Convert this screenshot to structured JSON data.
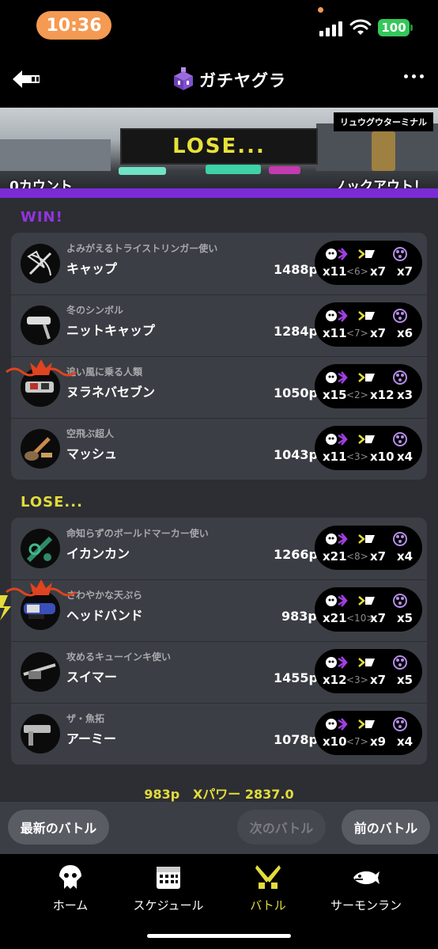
{
  "status_bar": {
    "time": "10:36",
    "battery": "100"
  },
  "header": {
    "title": "ガチヤグラ"
  },
  "banner": {
    "stage": "リュウグウターミナル",
    "result": "LOSE...",
    "left_count": "0カウント",
    "right_text": "ノックアウト！"
  },
  "win_label": "WIN!",
  "lose_label": "LOSE...",
  "win_team": [
    {
      "title": "よみがえるトライストリンガー使い",
      "name": "キャップ",
      "points": "1488p",
      "kills": "x11",
      "assists": "<6>",
      "specials_killed": "x7",
      "special_count": "x7",
      "weapon_icon": "bow-weapon-icon"
    },
    {
      "title": "冬のシンボル",
      "name": "ニットキャップ",
      "points": "1284p",
      "kills": "x11",
      "assists": "<7>",
      "specials_killed": "x7",
      "special_count": "x6",
      "weapon_icon": "roller-weapon-icon"
    },
    {
      "title": "追い風に乗る人類",
      "name": "ヌラネバセブン",
      "points": "1050p",
      "kills": "x15",
      "assists": "<2>",
      "specials_killed": "x12",
      "special_count": "x3",
      "weapon_icon": "shooter-weapon-icon"
    },
    {
      "title": "空飛ぶ超人",
      "name": "マッシュ",
      "points": "1043p",
      "kills": "x11",
      "assists": "<3>",
      "specials_killed": "x10",
      "special_count": "x4",
      "weapon_icon": "brush-weapon-icon"
    }
  ],
  "lose_team": [
    {
      "title": "命知らずのボールドマーカー使い",
      "name": "イカンカン",
      "points": "1266p",
      "kills": "x21",
      "assists": "<8>",
      "specials_killed": "x7",
      "special_count": "x4",
      "weapon_icon": "marker-weapon-icon"
    },
    {
      "title": "さわやかな天ぷら",
      "name": "ヘッドバンド",
      "points": "983p",
      "kills": "x21",
      "assists": "<10>",
      "specials_killed": "x7",
      "special_count": "x5",
      "weapon_icon": "blaster-weapon-icon"
    },
    {
      "title": "攻めるキューインキ使い",
      "name": "スイマー",
      "points": "1455p",
      "kills": "x12",
      "assists": "<3>",
      "specials_killed": "x7",
      "special_count": "x5",
      "weapon_icon": "charger-weapon-icon"
    },
    {
      "title": "ザ・魚拓",
      "name": "アーミー",
      "points": "1078p",
      "kills": "x10",
      "assists": "<7>",
      "specials_killed": "x9",
      "special_count": "x4",
      "weapon_icon": "splatling-weapon-icon"
    }
  ],
  "summary": {
    "points": "983p",
    "power": "Xパワー 2837.0"
  },
  "buttons": {
    "latest": "最新のバトル",
    "next": "次のバトル",
    "prev": "前のバトル"
  },
  "tabs": [
    {
      "label": "ホーム",
      "icon": "squid-icon"
    },
    {
      "label": "スケジュール",
      "icon": "calendar-icon"
    },
    {
      "label": "バトル",
      "icon": "crossed-weapons-icon"
    },
    {
      "label": "サーモンラン",
      "icon": "salmon-icon"
    }
  ],
  "colors": {
    "win": "#9333e0",
    "lose": "#e3dc3a",
    "accent_orange": "#f59a52",
    "battery_green": "#34c759"
  }
}
